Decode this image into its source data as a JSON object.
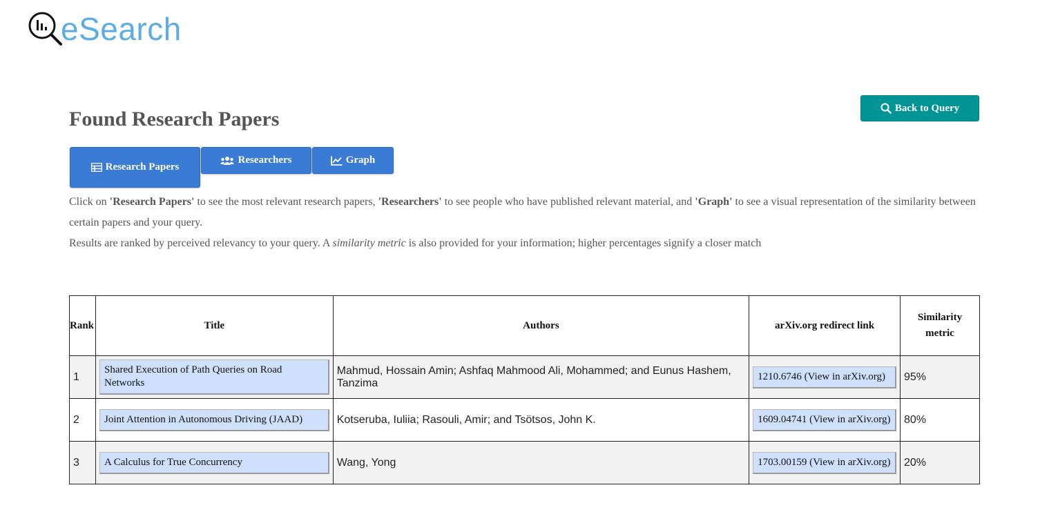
{
  "logo": {
    "text": "eSearch"
  },
  "header": {
    "title": "Found Research Papers",
    "back_button_label": "Back to Query"
  },
  "tabs": [
    {
      "label": "Research Papers",
      "icon": "table-icon",
      "active": true
    },
    {
      "label": "Researchers",
      "icon": "users-icon",
      "active": false
    },
    {
      "label": "Graph",
      "icon": "chart-line-icon",
      "active": false
    }
  ],
  "description": {
    "line1_part1": "Click on ",
    "line1_bold1": "'Research Papers'",
    "line1_part2": " to see the most relevant research papers, ",
    "line1_bold2": "'Researchers'",
    "line1_part3": " to see people who have published relevant material, and ",
    "line1_bold3": "'Graph'",
    "line1_part4": " to see a visual representation of the similarity between certain papers and your query.",
    "line2_part1": "Results are ranked by perceived relevancy to your query. A ",
    "line2_italic": "similarity metric",
    "line2_part2": " is also provided for your information; higher percentages signify a closer match"
  },
  "table": {
    "headers": [
      "Rank",
      "Title",
      "Authors",
      "arXiv.org redirect link",
      "Similarity metric"
    ],
    "rows": [
      {
        "rank": "1",
        "title": "Shared Execution of Path Queries on Road Networks",
        "authors": "Mahmud, Hossain Amin; Ashfaq Mahmood Ali, Mohammed; and Eunus Hashem, Tanzima",
        "link": "1210.6746 (View in arXiv.org)",
        "similarity": "95%"
      },
      {
        "rank": "2",
        "title": "Joint Attention in Autonomous Driving (JAAD)",
        "authors": "Kotseruba, Iuliia; Rasouli, Amir; and Tsötsos, John K.",
        "link": "1609.04741 (View in arXiv.org)",
        "similarity": "80%"
      },
      {
        "rank": "3",
        "title": "A Calculus for True Concurrency",
        "authors": "Wang, Yong",
        "link": "1703.00159 (View in arXiv.org)",
        "similarity": "20%"
      }
    ]
  },
  "colors": {
    "accent_teal": "#009494",
    "tab_blue": "#3a7bd5",
    "logo_blue": "#5dade2",
    "cell_button": "#cfe0fc"
  }
}
